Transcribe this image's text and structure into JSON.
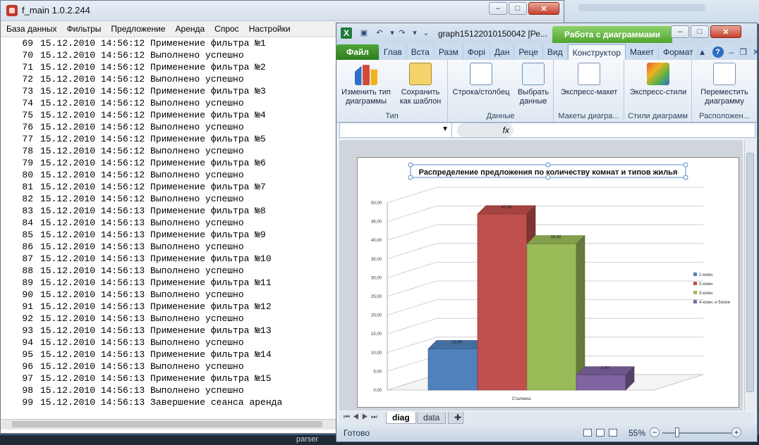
{
  "left_window": {
    "title": "f_main 1.0.2.244",
    "menu": [
      "База данных",
      "Фильтры",
      "Предложение",
      "Аренда",
      "Спрос",
      "Настройки"
    ],
    "log_rows": [
      {
        "n": "69",
        "text": "15.12.2010 14:56:12 Применение фильтра №1"
      },
      {
        "n": "70",
        "text": "15.12.2010 14:56:12 Выполнено успешно"
      },
      {
        "n": "71",
        "text": "15.12.2010 14:56:12 Применение фильтра №2"
      },
      {
        "n": "72",
        "text": "15.12.2010 14:56:12 Выполнено успешно"
      },
      {
        "n": "73",
        "text": "15.12.2010 14:56:12 Применение фильтра №3"
      },
      {
        "n": "74",
        "text": "15.12.2010 14:56:12 Выполнено успешно"
      },
      {
        "n": "75",
        "text": "15.12.2010 14:56:12 Применение фильтра №4"
      },
      {
        "n": "76",
        "text": "15.12.2010 14:56:12 Выполнено успешно"
      },
      {
        "n": "77",
        "text": "15.12.2010 14:56:12 Применение фильтра №5"
      },
      {
        "n": "78",
        "text": "15.12.2010 14:56:12 Выполнено успешно"
      },
      {
        "n": "79",
        "text": "15.12.2010 14:56:12 Применение фильтра №6"
      },
      {
        "n": "80",
        "text": "15.12.2010 14:56:12 Выполнено успешно"
      },
      {
        "n": "81",
        "text": "15.12.2010 14:56:12 Применение фильтра №7"
      },
      {
        "n": "82",
        "text": "15.12.2010 14:56:12 Выполнено успешно"
      },
      {
        "n": "83",
        "text": "15.12.2010 14:56:13 Применение фильтра №8"
      },
      {
        "n": "84",
        "text": "15.12.2010 14:56:13 Выполнено успешно"
      },
      {
        "n": "85",
        "text": "15.12.2010 14:56:13 Применение фильтра №9"
      },
      {
        "n": "86",
        "text": "15.12.2010 14:56:13 Выполнено успешно"
      },
      {
        "n": "87",
        "text": "15.12.2010 14:56:13 Применение фильтра №10"
      },
      {
        "n": "88",
        "text": "15.12.2010 14:56:13 Выполнено успешно"
      },
      {
        "n": "89",
        "text": "15.12.2010 14:56:13 Применение фильтра №11"
      },
      {
        "n": "90",
        "text": "15.12.2010 14:56:13 Выполнено успешно"
      },
      {
        "n": "91",
        "text": "15.12.2010 14:56:13 Применение фильтра №12"
      },
      {
        "n": "92",
        "text": "15.12.2010 14:56:13 Выполнено успешно"
      },
      {
        "n": "93",
        "text": "15.12.2010 14:56:13 Применение фильтра №13"
      },
      {
        "n": "94",
        "text": "15.12.2010 14:56:13 Выполнено успешно"
      },
      {
        "n": "95",
        "text": "15.12.2010 14:56:13 Применение фильтра №14"
      },
      {
        "n": "96",
        "text": "15.12.2010 14:56:13 Выполнено успешно"
      },
      {
        "n": "97",
        "text": "15.12.2010 14:56:13 Применение фильтра №15"
      },
      {
        "n": "98",
        "text": "15.12.2010 14:56:13 Выполнено успешно"
      },
      {
        "n": "99",
        "text": "15.12.2010 14:56:13 Завершение сеанса аренда"
      }
    ]
  },
  "excel": {
    "doc_title": "graph15122010150042 [Ре...",
    "context_tab": "Работа с диаграммами",
    "tabs": [
      "Файл",
      "Глав",
      "Вста",
      "Разм",
      "Форі",
      "Дан",
      "Реце",
      "Вид",
      "Конструктор",
      "Макет",
      "Формат"
    ],
    "active_tab": "Конструктор",
    "ribbon": {
      "change_type": "Изменить тип диаграммы",
      "save_template": "Сохранить как шаблон",
      "group_type": "Тип",
      "row_col": "Строка/столбец",
      "select_data": "Выбрать данные",
      "group_data": "Данные",
      "quick_layout": "Экспресс-макет",
      "group_layouts": "Макеты диагра...",
      "quick_styles": "Экспресс-стили",
      "group_styles": "Стили диаграмм",
      "move_chart": "Переместить диаграмму",
      "group_location": "Расположен..."
    },
    "formula_fx": "fx",
    "sheet_tabs": [
      "diag",
      "data"
    ],
    "active_sheet": "diag",
    "status": "Готово",
    "zoom": "55%"
  },
  "desktop_label": "parser",
  "colors": {
    "series1": "#4f81bd",
    "series2": "#c0504d",
    "series3": "#9bbb59",
    "series4": "#8064a2"
  },
  "chart_data": {
    "type": "bar",
    "title": "Распределение предложения по количеству комнат и типов жилья",
    "categories": [
      "Сталинка"
    ],
    "series": [
      {
        "name": "1-комн.",
        "values": [
          11.0
        ]
      },
      {
        "name": "2-комн.",
        "values": [
          47.0
        ]
      },
      {
        "name": "3-комн.",
        "values": [
          39.0
        ]
      },
      {
        "name": "4-комн. и более",
        "values": [
          4.0
        ]
      }
    ],
    "data_labels": [
      "11,00",
      "47,00",
      "39,00",
      "4,00"
    ],
    "y_ticks": [
      "0,00",
      "5,00",
      "10,00",
      "15,00",
      "20,00",
      "25,00",
      "30,00",
      "35,00",
      "40,00",
      "45,00",
      "50,00"
    ],
    "ylim": [
      0,
      50
    ],
    "grid": true,
    "legend": "right",
    "three_d": true
  }
}
